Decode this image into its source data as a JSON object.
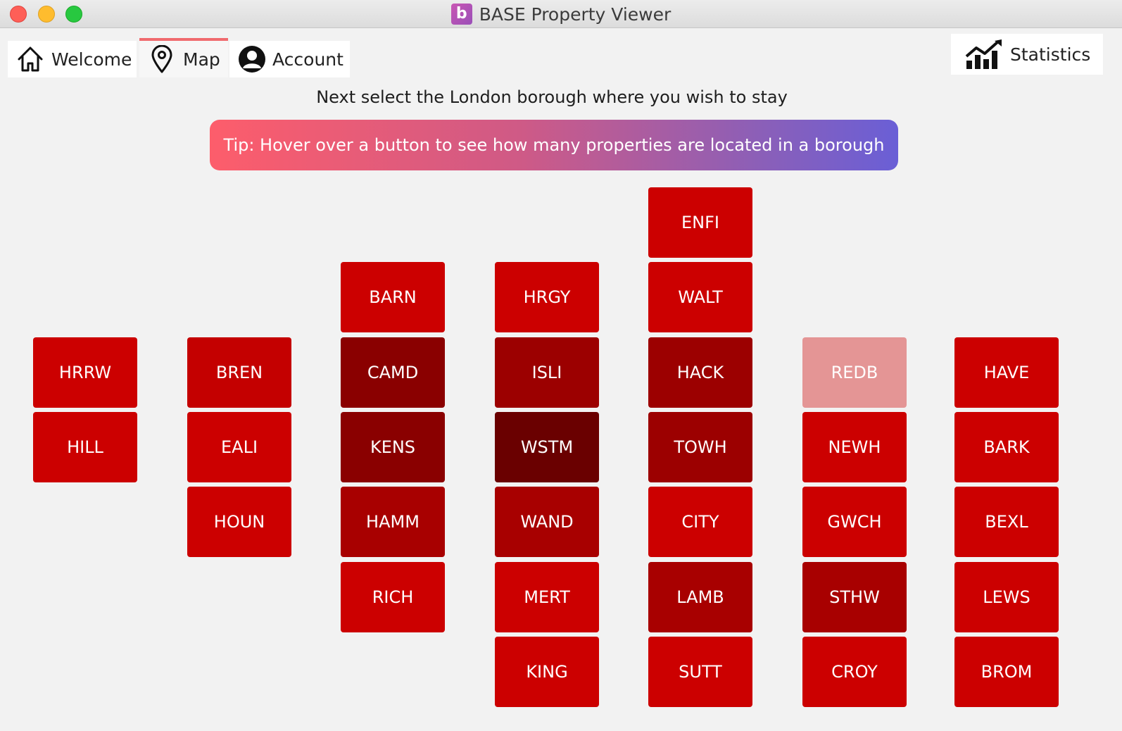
{
  "window": {
    "title": "BASE Property Viewer",
    "app_icon_letter": "b"
  },
  "tabs": [
    {
      "label": "Welcome",
      "icon": "home-icon",
      "active": false
    },
    {
      "label": "Map",
      "icon": "map-pin-icon",
      "active": true
    },
    {
      "label": "Account",
      "icon": "user-icon",
      "active": false
    }
  ],
  "statistics_button": {
    "label": "Statistics",
    "icon": "chart-trend-icon"
  },
  "prompt": "Next select the London borough where you wish to stay",
  "tip": "Tip: Hover over a button to see how many properties are located in a borough",
  "colors": {
    "shade_1": "#cc0000",
    "shade_2": "#c40000",
    "shade_3": "#a80000",
    "shade_4": "#9c0000",
    "shade_5": "#8a0000",
    "shade_6": "#6a0000",
    "faded": "#e49595",
    "tab_active_accent": "#f06a6e"
  },
  "boroughs": [
    {
      "code": "ENFI",
      "col": 4,
      "row": 0,
      "shade": "shade_1"
    },
    {
      "code": "BARN",
      "col": 2,
      "row": 1,
      "shade": "shade_1"
    },
    {
      "code": "HRGY",
      "col": 3,
      "row": 1,
      "shade": "shade_1"
    },
    {
      "code": "WALT",
      "col": 4,
      "row": 1,
      "shade": "shade_1"
    },
    {
      "code": "HRRW",
      "col": 0,
      "row": 2,
      "shade": "shade_1"
    },
    {
      "code": "BREN",
      "col": 1,
      "row": 2,
      "shade": "shade_2"
    },
    {
      "code": "CAMD",
      "col": 2,
      "row": 2,
      "shade": "shade_5"
    },
    {
      "code": "ISLI",
      "col": 3,
      "row": 2,
      "shade": "shade_4"
    },
    {
      "code": "HACK",
      "col": 4,
      "row": 2,
      "shade": "shade_4"
    },
    {
      "code": "REDB",
      "col": 5,
      "row": 2,
      "shade": "faded"
    },
    {
      "code": "HAVE",
      "col": 6,
      "row": 2,
      "shade": "shade_1"
    },
    {
      "code": "HILL",
      "col": 0,
      "row": 3,
      "shade": "shade_1"
    },
    {
      "code": "EALI",
      "col": 1,
      "row": 3,
      "shade": "shade_1"
    },
    {
      "code": "KENS",
      "col": 2,
      "row": 3,
      "shade": "shade_5"
    },
    {
      "code": "WSTM",
      "col": 3,
      "row": 3,
      "shade": "shade_6"
    },
    {
      "code": "TOWH",
      "col": 4,
      "row": 3,
      "shade": "shade_4"
    },
    {
      "code": "NEWH",
      "col": 5,
      "row": 3,
      "shade": "shade_1"
    },
    {
      "code": "BARK",
      "col": 6,
      "row": 3,
      "shade": "shade_1"
    },
    {
      "code": "HOUN",
      "col": 1,
      "row": 4,
      "shade": "shade_1"
    },
    {
      "code": "HAMM",
      "col": 2,
      "row": 4,
      "shade": "shade_3"
    },
    {
      "code": "WAND",
      "col": 3,
      "row": 4,
      "shade": "shade_3"
    },
    {
      "code": "CITY",
      "col": 4,
      "row": 4,
      "shade": "shade_1"
    },
    {
      "code": "GWCH",
      "col": 5,
      "row": 4,
      "shade": "shade_1"
    },
    {
      "code": "BEXL",
      "col": 6,
      "row": 4,
      "shade": "shade_1"
    },
    {
      "code": "RICH",
      "col": 2,
      "row": 5,
      "shade": "shade_1"
    },
    {
      "code": "MERT",
      "col": 3,
      "row": 5,
      "shade": "shade_1"
    },
    {
      "code": "LAMB",
      "col": 4,
      "row": 5,
      "shade": "shade_3"
    },
    {
      "code": "STHW",
      "col": 5,
      "row": 5,
      "shade": "shade_3"
    },
    {
      "code": "LEWS",
      "col": 6,
      "row": 5,
      "shade": "shade_1"
    },
    {
      "code": "KING",
      "col": 3,
      "row": 6,
      "shade": "shade_1"
    },
    {
      "code": "SUTT",
      "col": 4,
      "row": 6,
      "shade": "shade_1"
    },
    {
      "code": "CROY",
      "col": 5,
      "row": 6,
      "shade": "shade_1"
    },
    {
      "code": "BROM",
      "col": 6,
      "row": 6,
      "shade": "shade_1"
    }
  ]
}
